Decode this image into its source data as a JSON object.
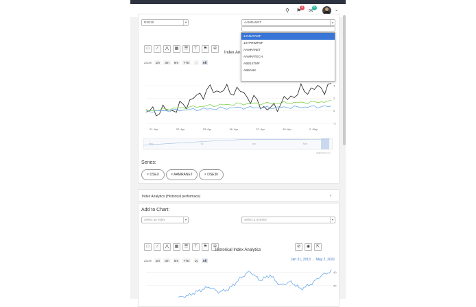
{
  "header": {
    "notif_badge_1": "3",
    "notif_badge_2": "5",
    "colors": {
      "badge_red": "#e74c5c",
      "badge_teal": "#29b8a8"
    }
  },
  "chart1": {
    "index_select": {
      "value": "DSE30"
    },
    "symbol_select": {
      "value": "AAMRANET",
      "search_placeholder": ""
    },
    "symbol_dropdown": [
      "1JANATAMF",
      "1STPRIMFMF",
      "AAMRANET",
      "AAMRATECH",
      "ABB1STMF",
      "ABBANK"
    ],
    "title": "Index Analy",
    "zoom": {
      "label": "Zoom",
      "buttons": [
        "1m",
        "3m",
        "6m",
        "YTD",
        "1y",
        "All"
      ]
    },
    "x_labels": [
      "21. Apr",
      "22. Apr",
      "23. Apr",
      "26. Apr",
      "27. Apr",
      "28. Apr",
      "2. May"
    ],
    "y_labels": [
      "4",
      "2",
      "0",
      "-2"
    ],
    "navigator_labels": [
      "Nov",
      "'16",
      "Jan",
      "Mar"
    ],
    "credit": "Highcharts.com"
  },
  "series": {
    "label": "Series:",
    "chips": [
      "× DSEX",
      "× AAMRANET",
      "× DSE30"
    ]
  },
  "historical": {
    "section_title": "Index Analytics (Historical performace)",
    "add_label": "Add to Chart:",
    "index_placeholder": "Select an index",
    "symbol_placeholder": "Select a Symbol",
    "title": "Historical Index Analytics",
    "zoom": {
      "label": "Zoom",
      "buttons": [
        "1m",
        "3m",
        "6m",
        "YTD",
        "1y",
        "All"
      ]
    },
    "date_from": "Jan 21, 2013",
    "date_sep": "→",
    "date_to": "May 2, 2021",
    "y_labels": [
      "40",
      "20"
    ]
  },
  "chart_data": [
    {
      "type": "line",
      "x": [
        "21. Apr",
        "22. Apr",
        "23. Apr",
        "26. Apr",
        "27. Apr",
        "28. Apr",
        "2. May"
      ],
      "ylim": [
        -2,
        5
      ],
      "series": [
        {
          "values": [
            -0.2,
            0.3,
            3.3,
            3.2,
            0.1,
            3.2,
            3.8
          ],
          "color": "#333333"
        },
        {
          "values": [
            0.0,
            0.4,
            0.8,
            1.1,
            1.2,
            1.3,
            1.5
          ],
          "color": "#7cd14a"
        },
        {
          "values": [
            -0.1,
            0.1,
            0.3,
            0.5,
            0.5,
            0.6,
            0.7
          ],
          "color": "#6aa8e8"
        }
      ]
    },
    {
      "type": "line",
      "title": "Historical Index Analytics",
      "ylim": [
        0,
        50
      ],
      "series": [
        {
          "values": [
            2,
            5,
            12,
            18,
            10,
            15,
            30,
            42,
            28,
            36,
            20,
            26,
            15,
            22,
            35,
            42
          ],
          "color": "#6aa8e8"
        }
      ]
    }
  ]
}
